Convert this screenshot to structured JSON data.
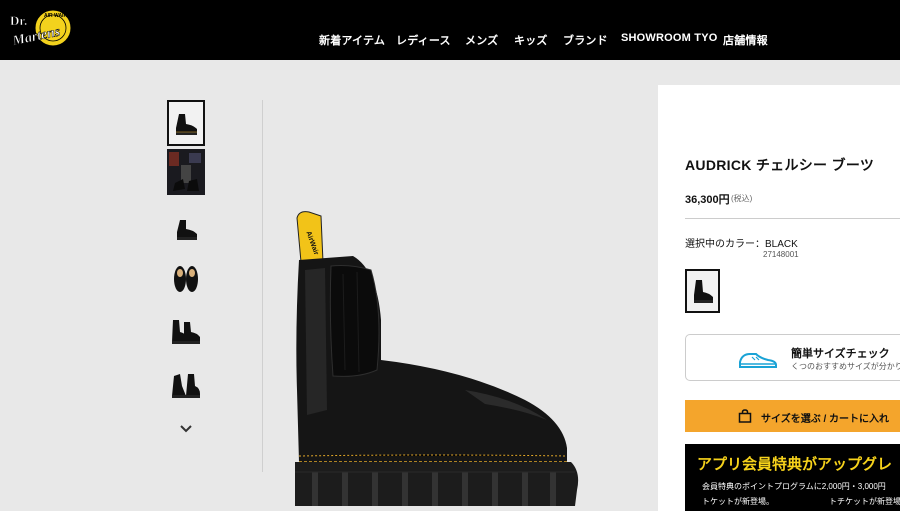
{
  "header": {
    "logo": {
      "line1": "Dr.",
      "line2": "Martens",
      "ring": "AIR WAIR"
    },
    "nav": [
      "新着アイテム",
      "レディース",
      "メンズ",
      "キッズ",
      "ブランド",
      "SHOWROOM TYO",
      "店舗情報"
    ]
  },
  "gallery": {
    "thumbnails": [
      "boot-front-angle",
      "lifestyle-photo",
      "boot-side",
      "boot-pair-top",
      "boot-pair-side",
      "boot-pair-back"
    ],
    "next_icon": "chevron-down-icon"
  },
  "product": {
    "title": "AUDRICK チェルシー ブーツ",
    "price": "36,300円",
    "tax_note": "(税込)",
    "color_label": "選択中のカラー：BLACK",
    "color_code": "27148001",
    "size_check": {
      "title": "簡単サイズチェック",
      "subtitle": "くつのおすすめサイズが分かりま"
    },
    "cart_button": "サイズを選ぶ / カートに入れ",
    "promo": {
      "title": "アプリ会員特典がアップグレ",
      "text1": "会員特典のポイントプログラムに2,000円・3,000円",
      "text2a": "トケットが新登場。",
      "text2b": "トチケットが新登場。"
    }
  },
  "colors": {
    "header_bg": "#000000",
    "page_bg": "#e8e8e8",
    "cart_button_bg": "#f4a52c",
    "promo_title": "#f6d21b",
    "shoe_icon": "#1aa3d6",
    "boot_stitch": "#e2a82a",
    "pull_tab": "#f2c318"
  }
}
